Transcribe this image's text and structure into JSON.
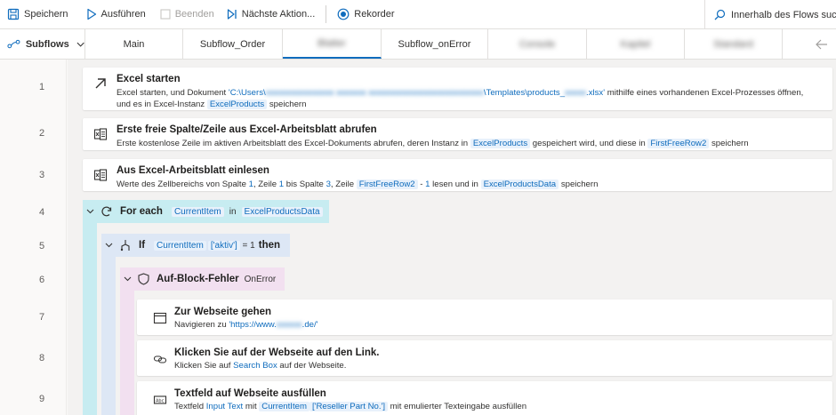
{
  "toolbar": {
    "save": "Speichern",
    "run": "Ausführen",
    "stop": "Beenden",
    "next_action": "Nächste Aktion...",
    "recorder": "Rekorder",
    "search": "Innerhalb des Flows suchen"
  },
  "tabs": {
    "subflows": "Subflows",
    "items": [
      {
        "label": "Main",
        "blurred": false
      },
      {
        "label": "Subflow_Order",
        "blurred": false
      },
      {
        "label": "Blatter",
        "blurred": true
      },
      {
        "label": "Subflow_onError",
        "blurred": false
      },
      {
        "label": "Console",
        "blurred": true
      },
      {
        "label": "Kapitel",
        "blurred": true
      },
      {
        "label": "Standard",
        "blurred": true
      }
    ]
  },
  "lines": [
    "1",
    "2",
    "3",
    "4",
    "5",
    "6",
    "7",
    "8",
    "9"
  ],
  "actions": {
    "a1": {
      "title": "Excel starten",
      "d1": "Excel starten, und Dokument ",
      "path_start": "'C:\\Users\\",
      "path_blur1": "xxxxxxxxxxxxxxxx xxxxxxx",
      "path_blur2": "xxxxxxxxxxxxxxxxxxxxxxxxxxx",
      "path_mid": "\\Templates\\products_",
      "path_blur3": "xxxxx",
      "path_end": ".xlsx'",
      "d2": " mithilfe eines vorhandenen Excel-Prozesses öffnen, und es in Excel-Instanz ",
      "var": "ExcelProducts",
      "d3": " speichern"
    },
    "a2": {
      "title": "Erste freie Spalte/Zeile aus Excel-Arbeitsblatt abrufen",
      "d1": "Erste kostenlose Zeile im aktiven Arbeitsblatt des Excel-Dokuments abrufen, deren Instanz in ",
      "var1": "ExcelProducts",
      "d2": " gespeichert wird, und diese in ",
      "var2": "FirstFreeRow2",
      "d3": " speichern"
    },
    "a3": {
      "title": "Aus Excel-Arbeitsblatt einlesen",
      "d1": "Werte des Zellbereichs von Spalte ",
      "n1": "1",
      "d2": ", Zeile ",
      "n2": "1",
      "d3": " bis Spalte ",
      "n3": "3",
      "d4": ", Zeile ",
      "var1": "FirstFreeRow2",
      "d5": " - ",
      "n4": "1",
      "d6": " lesen und in ",
      "var2": "ExcelProductsData",
      "d7": " speichern"
    },
    "foreach": {
      "title": "For each",
      "var1": "CurrentItem",
      "in": "in",
      "var2": "ExcelProductsData"
    },
    "if": {
      "title": "If",
      "var": "CurrentItem",
      "key": "['aktiv']",
      "eq": " = ",
      "num": "1",
      "then": "then"
    },
    "onerror": {
      "title": "Auf-Block-Fehler",
      "label": "OnError"
    },
    "a7": {
      "title": "Zur Webseite gehen",
      "d1": "Navigieren zu ",
      "url_start": "'https://www.",
      "url_blur": "xxxxxx",
      "url_end": ".de/'"
    },
    "a8": {
      "title": "Klicken Sie auf der Webseite auf den Link.",
      "d1": "Klicken Sie auf ",
      "link": "Search Box",
      "d2": " auf der Webseite."
    },
    "a9": {
      "title": "Textfeld auf Webseite ausfüllen",
      "d1": "Textfeld ",
      "link": "Input Text",
      "d2": " mit ",
      "var": "CurrentItem",
      "key": "['Reseller Part No.']",
      "d3": " mit emulierter Texteingabe ausfüllen"
    }
  }
}
